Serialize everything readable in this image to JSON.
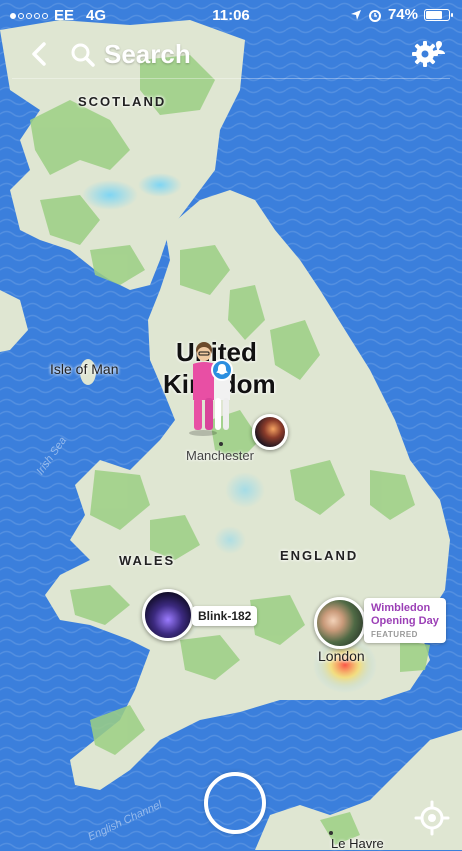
{
  "status_bar": {
    "carrier": "EE",
    "network": "4G",
    "time": "11:06",
    "battery": "74%",
    "battery_level": 0.74
  },
  "topbar": {
    "search_label": "Search"
  },
  "map": {
    "regions": [
      "SCOTLAND",
      "WALES",
      "ENGLAND"
    ],
    "country_line1": "United",
    "country_line2": "Kingdom",
    "places": [
      "Isle of Man",
      "Manchester",
      "London",
      "Le Havre"
    ],
    "seas": [
      "Irish Sea",
      "English Channel"
    ]
  },
  "stories": {
    "blink_label": "Blink-182",
    "featured_title": "Wimbledon Opening Day",
    "featured_sub": "FEATURED"
  },
  "colors": {
    "sea": "#3b7fdc",
    "land": "#dfe6d2",
    "green": "#9ccf84",
    "featured": "#9b3fb6"
  },
  "icons": {
    "back": "chevron-left-icon",
    "search": "search-icon",
    "settings": "gear-icon",
    "locate": "locate-icon"
  }
}
